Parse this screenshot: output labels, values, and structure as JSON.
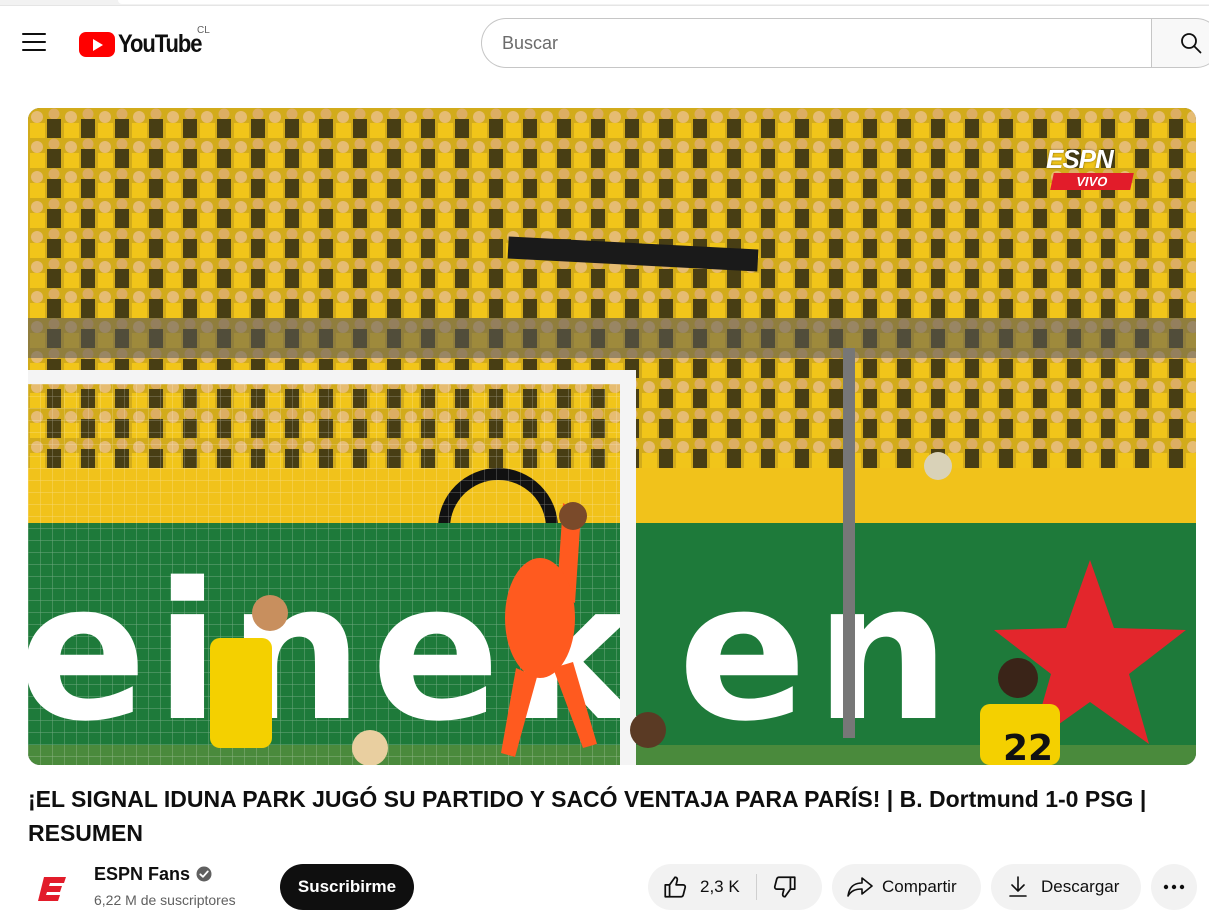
{
  "masthead": {
    "logo_text": "YouTube",
    "country_code": "CL",
    "search_placeholder": "Buscar",
    "icons": [
      "menu-icon",
      "youtube-logo",
      "search-icon"
    ]
  },
  "player": {
    "overlay_brand": "ESPN",
    "overlay_live": "VIVO"
  },
  "video": {
    "title": "¡EL SIGNAL IDUNA PARK JUGÓ SU PARTIDO Y SACÓ VENTAJA PARA PARÍS! | B. Dortmund 1-0 PSG | RESUMEN"
  },
  "channel": {
    "name": "ESPN Fans",
    "subscribers": "6,22 M de suscriptores",
    "avatar_letter": "E",
    "subscribe_label": "Suscribirme"
  },
  "actions": {
    "like_count": "2,3 K",
    "share_label": "Compartir",
    "download_label": "Descargar",
    "icons": [
      "like-icon",
      "dislike-icon",
      "share-icon",
      "download-icon",
      "more-icon",
      "verified-icon"
    ]
  },
  "colors": {
    "brand_red": "#ff0000",
    "espn_red": "#e21c2a",
    "dortmund_yellow": "#f5c400",
    "pitch_green": "#1e7a3a"
  }
}
